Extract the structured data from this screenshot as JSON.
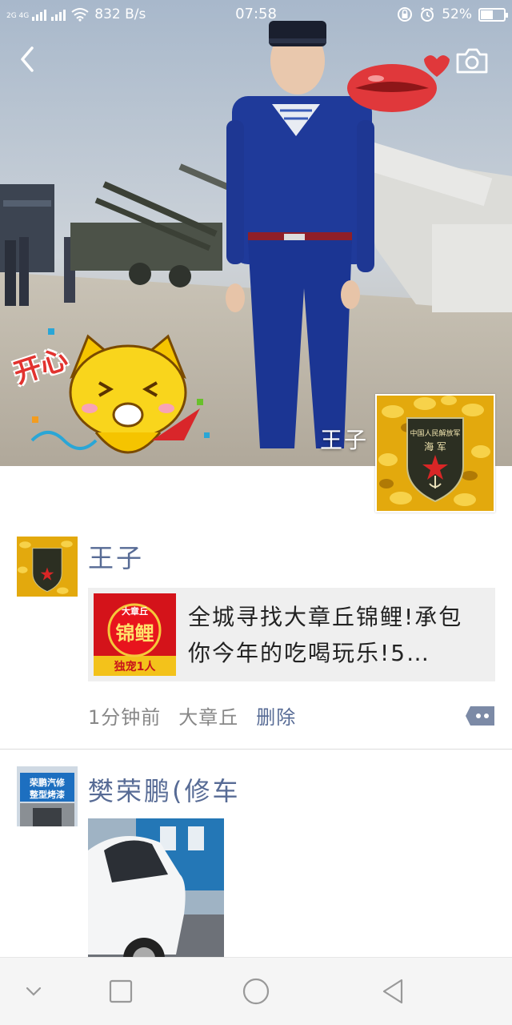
{
  "status_bar": {
    "network_label": "2G 4G",
    "speed": "832 B/s",
    "time": "07:58",
    "battery_text": "52%",
    "battery_level": 0.52
  },
  "header": {
    "back_icon": "chevron-left-icon",
    "camera_icon": "camera-icon"
  },
  "cover": {
    "sticker_text": "开心"
  },
  "profile": {
    "name": "王子",
    "avatar_text_top": "中国人民解放军",
    "avatar_text_bottom": "海 军"
  },
  "posts": [
    {
      "user": "王子",
      "share": {
        "thumb_top": "大章丘",
        "thumb_main": "锦鲤",
        "thumb_bottom": "独宠1人",
        "text": "全城寻找大章丘锦鲤!承包你今年的吃喝玩乐!5…"
      },
      "time": "1分钟前",
      "source": "大章丘",
      "delete_label": "删除"
    },
    {
      "user": "樊荣鹏(修车",
      "avatar_sign_line1": "荣鹏汽修",
      "avatar_sign_line2": "整型烤漆"
    }
  ],
  "colors": {
    "link": "#576b95",
    "meta": "#888888",
    "share_bg": "#efefef"
  }
}
